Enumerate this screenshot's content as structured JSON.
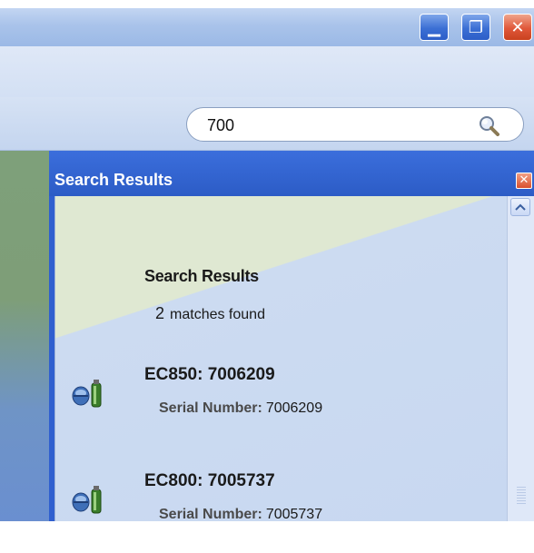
{
  "window": {
    "minimize_glyph": "▁",
    "restore_glyph": "❐",
    "close_glyph": "✕"
  },
  "search": {
    "value": "700",
    "icon": "magnifier-icon"
  },
  "panel": {
    "title": "Search Results",
    "close_glyph": "✕",
    "heading": "Search Results",
    "match_count": "2",
    "match_text": "matches found",
    "results": [
      {
        "title": "EC850: 7006209",
        "serial_label": "Serial Number:",
        "serial_value": "7006209",
        "icon": "device-icon"
      },
      {
        "title": "EC800: 7005737",
        "serial_label": "Serial Number:",
        "serial_value": "7005737",
        "icon": "device-icon"
      }
    ]
  },
  "colors": {
    "panel_header": "#2f5fcf",
    "titlebar": "#a9c3ea",
    "close_button": "#e0583a"
  }
}
